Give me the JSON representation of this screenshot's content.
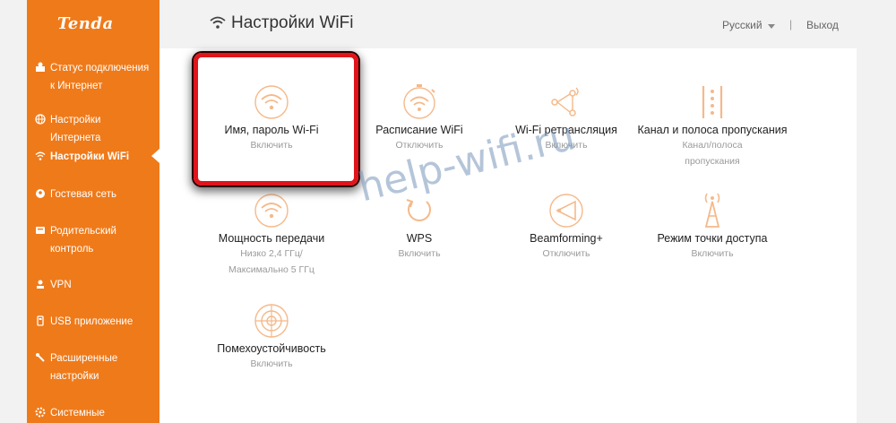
{
  "brand": {
    "logo": "Tenda"
  },
  "sidebar": {
    "items": [
      {
        "label": "Статус подключения к Интернет",
        "icon": "status-icon"
      },
      {
        "label": "Настройки Интернета",
        "icon": "globe-icon"
      },
      {
        "label": "Настройки WiFi",
        "icon": "wifi-icon",
        "active": true
      },
      {
        "label": "Гостевая сеть",
        "icon": "guest-icon"
      },
      {
        "label": "Родительский контроль",
        "icon": "parental-icon"
      },
      {
        "label": "VPN",
        "icon": "vpn-icon"
      },
      {
        "label": "USB приложение",
        "icon": "usb-icon"
      },
      {
        "label": "Расширенные настройки",
        "icon": "wrench-icon"
      },
      {
        "label": "Системные настройки",
        "icon": "gear-icon"
      }
    ]
  },
  "header": {
    "title": "Настройки WiFi",
    "language": "Русский",
    "separator": "|",
    "logout": "Выход"
  },
  "tiles": [
    {
      "label": "Имя, пароль Wi-Fi",
      "status": "Включить",
      "icon": "wifi-circle-icon"
    },
    {
      "label": "Расписание WiFi",
      "status": "Отключить",
      "icon": "wifi-schedule-icon"
    },
    {
      "label": "Wi-Fi ретрансляция",
      "status": "Включить",
      "icon": "relay-icon"
    },
    {
      "label": "Канал и полоса пропускания",
      "status": "Канал/полоса пропускания",
      "icon": "channel-icon"
    },
    {
      "label": "Мощность передачи",
      "status": "Низко 2,4 ГГц/ Максимально 5 ГГц",
      "icon": "wifi-power-icon"
    },
    {
      "label": "WPS",
      "status": "Включить",
      "icon": "wps-icon"
    },
    {
      "label": "Beamforming+",
      "status": "Отключить",
      "icon": "beamforming-icon"
    },
    {
      "label": "Режим точки доступа",
      "status": "Включить",
      "icon": "access-point-icon"
    },
    {
      "label": "Помехоустойчивость",
      "status": "Включить",
      "icon": "interference-icon"
    }
  ],
  "watermark": "help-wifi.ru",
  "colors": {
    "accent": "#ef7a1a",
    "icon": "#f5b98a",
    "highlight": "#e0151b"
  }
}
